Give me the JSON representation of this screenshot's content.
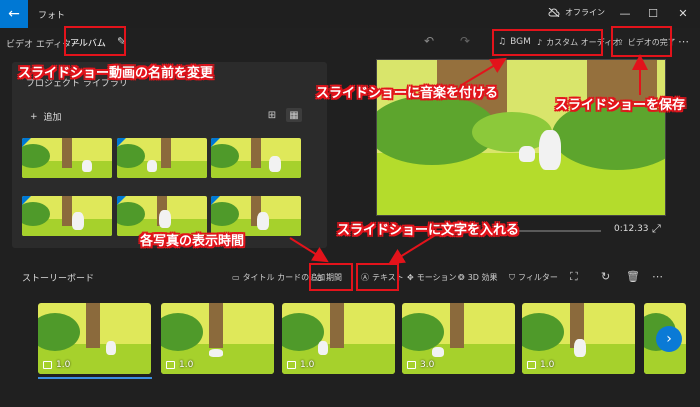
{
  "window": {
    "back_icon": "←",
    "title": "フォト",
    "offline_label": "オフライン",
    "minimize": "—",
    "maximize": "☐",
    "close": "✕",
    "offline_icon": "cloud-off-icon"
  },
  "toolbar": {
    "breadcrumb": "ビデオ エディター",
    "project_name": "アルバム",
    "rename_icon": "✎",
    "undo_icon": "↶",
    "redo_icon": "↷",
    "bgm": "BGM",
    "custom_audio": "カスタム オーディオ",
    "finish_video": "ビデオの完了",
    "more": "⋯"
  },
  "library": {
    "title": "プロジェクト ライブラリ",
    "add_label": "追加",
    "add_icon": "+"
  },
  "preview": {
    "time": "0:12.33",
    "expand_icon": "⤢"
  },
  "storyboard": {
    "title": "ストーリーボード",
    "title_card": "タイトル カードの追加",
    "duration": "期間",
    "text": "テキスト",
    "motion": "モーション",
    "effects3d": "3D 効果",
    "filter": "フィルター",
    "more": "⋯",
    "cards": [
      {
        "duration": "1.0"
      },
      {
        "duration": "1.0"
      },
      {
        "duration": "1.0"
      },
      {
        "duration": "3.0"
      },
      {
        "duration": "1.0"
      }
    ],
    "next_icon": "›"
  },
  "annotations": {
    "rename": "スライドショー動画の名前を変更",
    "music": "スライドショーに音楽を付ける",
    "save": "スライドショーを保存",
    "text": "スライドショーに文字を入れる",
    "duration": "各写真の表示時間"
  },
  "colors": {
    "accent": "#0078d4",
    "highlight": "#e3131b",
    "background": "#202020"
  }
}
